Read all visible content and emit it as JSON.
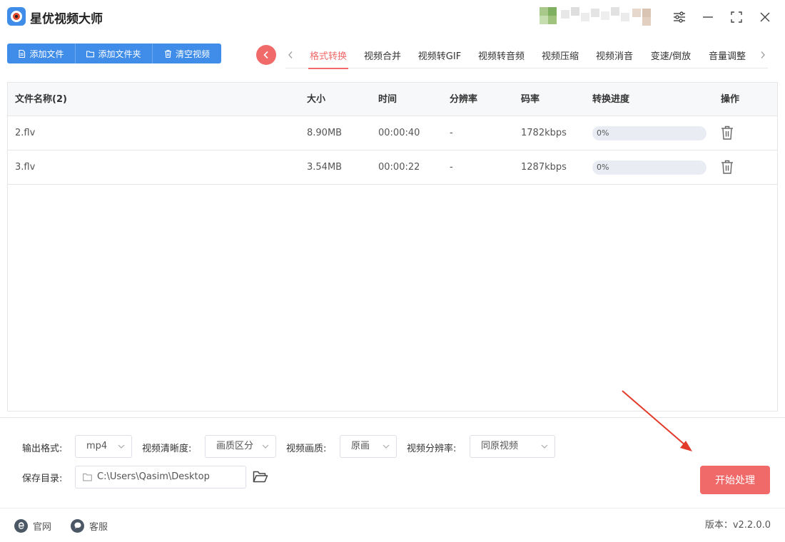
{
  "app": {
    "title": "星优视频大师"
  },
  "toolbar": {
    "add_file": "添加文件",
    "add_folder": "添加文件夹",
    "clear_videos": "清空视频"
  },
  "tabs": [
    {
      "label": "格式转换",
      "active": true
    },
    {
      "label": "视频合并",
      "active": false
    },
    {
      "label": "视频转GIF",
      "active": false
    },
    {
      "label": "视频转音频",
      "active": false
    },
    {
      "label": "视频压缩",
      "active": false
    },
    {
      "label": "视频消音",
      "active": false
    },
    {
      "label": "变速/倒放",
      "active": false
    },
    {
      "label": "音量调整",
      "active": false
    }
  ],
  "table": {
    "headers": {
      "name": "文件名称(2)",
      "size": "大小",
      "time": "时间",
      "resolution": "分辨率",
      "bitrate": "码率",
      "progress": "转换进度",
      "action": "操作"
    },
    "rows": [
      {
        "name": "2.flv",
        "size": "8.90MB",
        "time": "00:00:40",
        "resolution": "-",
        "bitrate": "1782kbps",
        "progress_text": "0%",
        "progress": 0
      },
      {
        "name": "3.flv",
        "size": "3.54MB",
        "time": "00:00:22",
        "resolution": "-",
        "bitrate": "1287kbps",
        "progress_text": "0%",
        "progress": 0
      }
    ]
  },
  "settings": {
    "output_format_label": "输出格式:",
    "output_format_value": "mp4",
    "clarity_label": "视频清晰度:",
    "clarity_value": "画质区分",
    "quality_label": "视频画质:",
    "quality_value": "原画",
    "resolution_label": "视频分辨率:",
    "resolution_value": "同原视频",
    "save_dir_label": "保存目录:",
    "save_dir_value": "C:\\Users\\Qasim\\Desktop",
    "start_button": "开始处理"
  },
  "footer": {
    "website": "官网",
    "support": "客服",
    "version": "版本：v2.2.0.0"
  },
  "colors": {
    "primary_blue": "#3f8de8",
    "accent_red": "#f06a6a"
  }
}
